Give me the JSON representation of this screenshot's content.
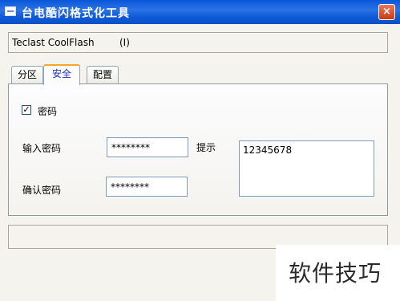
{
  "window": {
    "title": "台电酷闪格式化工具",
    "close_label": "×"
  },
  "device": {
    "name": "Teclast CoolFlash",
    "code": "(I)"
  },
  "tabs": [
    {
      "label": "分区"
    },
    {
      "label": "安全",
      "active": true
    },
    {
      "label": "配置"
    }
  ],
  "security": {
    "password_checkbox_label": "密码",
    "password_checked": true,
    "check_mark": "✓",
    "enter_password_label": "输入密码",
    "enter_password_value": "********",
    "confirm_password_label": "确认密码",
    "confirm_password_value": "********",
    "hint_label": "提示",
    "hint_value": "12345678"
  },
  "watermark": {
    "text": "软件技巧"
  }
}
